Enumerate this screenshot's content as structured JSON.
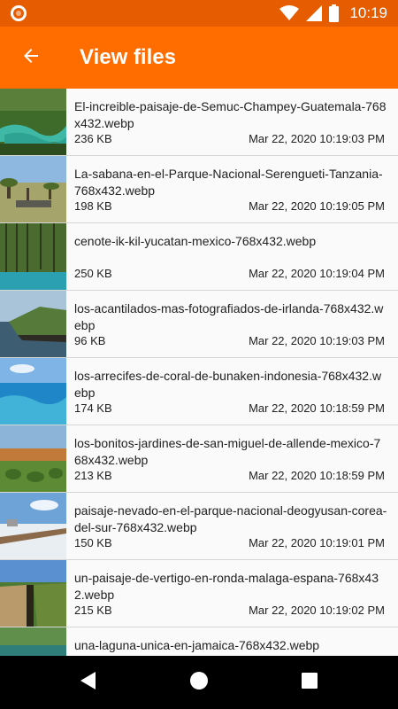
{
  "status_bar": {
    "time": "10:19",
    "icons": [
      "app-notification-icon",
      "wifi-icon",
      "signal-icon",
      "battery-icon"
    ]
  },
  "app_bar": {
    "title": "View files",
    "back_icon": "arrow-back-icon"
  },
  "files": [
    {
      "name": "El-increible-paisaje-de-Semuc-Champey-Guatemala-768x432.webp",
      "size": "236 KB",
      "date": "Mar 22, 2020 10:19:03 PM",
      "thumb": "semuc-champey"
    },
    {
      "name": "La-sabana-en-el-Parque-Nacional-Serengueti-Tanzania-768x432.webp",
      "size": "198 KB",
      "date": "Mar 22, 2020 10:19:05 PM",
      "thumb": "serengeti"
    },
    {
      "name": "cenote-ik-kil-yucatan-mexico-768x432.webp",
      "size": "250 KB",
      "date": "Mar 22, 2020 10:19:04 PM",
      "thumb": "cenote"
    },
    {
      "name": "los-acantilados-mas-fotografiados-de-irlanda-768x432.webp",
      "size": "96 KB",
      "date": "Mar 22, 2020 10:19:03 PM",
      "thumb": "cliffs"
    },
    {
      "name": "los-arrecifes-de-coral-de-bunaken-indonesia-768x432.webp",
      "size": "174 KB",
      "date": "Mar 22, 2020 10:18:59 PM",
      "thumb": "reef"
    },
    {
      "name": "los-bonitos-jardines-de-san-miguel-de-allende-mexico-768x432.webp",
      "size": "213 KB",
      "date": "Mar 22, 2020 10:18:59 PM",
      "thumb": "gardens"
    },
    {
      "name": "paisaje-nevado-en-el-parque-nacional-deogyusan-corea-del-sur-768x432.webp",
      "size": "150 KB",
      "date": "Mar 22, 2020 10:19:01 PM",
      "thumb": "snow"
    },
    {
      "name": "un-paisaje-de-vertigo-en-ronda-malaga-espana-768x432.webp",
      "size": "215 KB",
      "date": "Mar 22, 2020 10:19:02 PM",
      "thumb": "ronda"
    },
    {
      "name": "una-laguna-unica-en-jamaica-768x432.webp",
      "size": "",
      "date": "",
      "thumb": "lagoon"
    }
  ],
  "nav_bar": {
    "icons": [
      "nav-back-icon",
      "nav-home-icon",
      "nav-recents-icon"
    ]
  },
  "colors": {
    "status_bar": "#e65c00",
    "app_bar": "#ff6d00",
    "nav_bar": "#000000"
  }
}
